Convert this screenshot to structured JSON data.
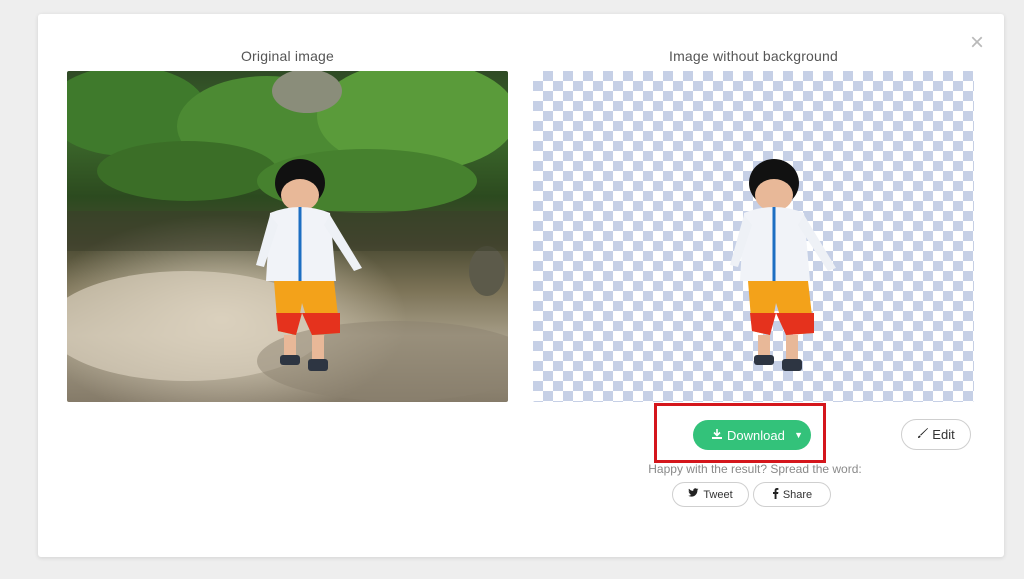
{
  "modal": {
    "close_symbol": "×",
    "left_title": "Original image",
    "right_title": "Image without background",
    "download": {
      "label": "Download",
      "icon": "download-icon",
      "caret": "▼"
    },
    "edit": {
      "label": "Edit",
      "icon": "brush-icon"
    },
    "spread_text": "Happy with the result? Spread the word:",
    "tweet": {
      "label": "Tweet",
      "icon": "twitter-icon"
    },
    "share": {
      "label": "Share",
      "icon": "facebook-icon"
    }
  },
  "colors": {
    "download_bg": "#33c27a",
    "highlight": "#d4161c",
    "checker": "#c6d0e6"
  }
}
